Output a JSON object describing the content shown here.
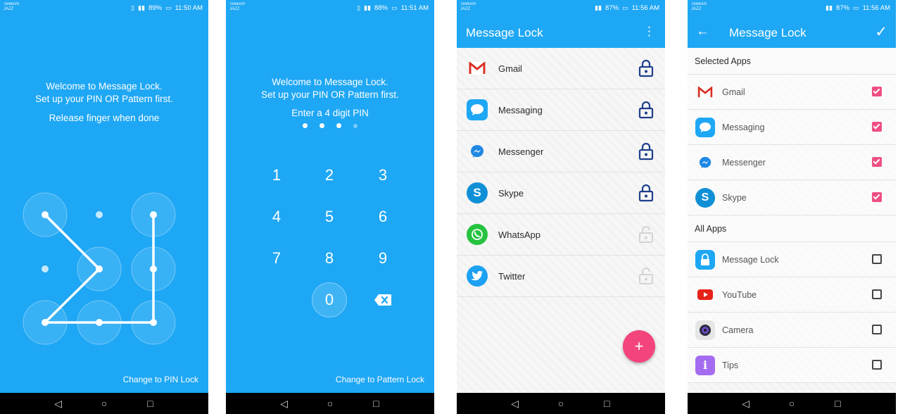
{
  "screen1": {
    "status": {
      "carrier": "Telekom\nJAZZ",
      "battery": "89%",
      "time": "11:50 AM"
    },
    "welcome_line1": "Welcome to Message Lock.",
    "welcome_line2": "Set up your PIN OR Pattern first.",
    "instruction": "Release finger when done",
    "change_link": "Change to PIN Lock"
  },
  "screen2": {
    "status": {
      "carrier": "Telekom\nJAZZ",
      "battery": "88%",
      "time": "11:51 AM"
    },
    "welcome_line1": "Welcome to Message Lock.",
    "welcome_line2": "Set up your PIN OR Pattern first.",
    "pin_prompt": "Enter a 4 digit PIN",
    "pin_entered": 3,
    "pin_length": 4,
    "keys": [
      "1",
      "2",
      "3",
      "4",
      "5",
      "6",
      "7",
      "8",
      "9",
      "0"
    ],
    "change_link": "Change to Pattern Lock"
  },
  "screen3": {
    "status": {
      "carrier": "Telekom\nJAZZ",
      "battery": "87%",
      "time": "11:56 AM"
    },
    "title": "Message Lock",
    "apps": [
      {
        "name": "Gmail",
        "icon": "gmail-icon",
        "locked": true
      },
      {
        "name": "Messaging",
        "icon": "messaging-icon",
        "locked": true
      },
      {
        "name": "Messenger",
        "icon": "messenger-icon",
        "locked": true
      },
      {
        "name": "Skype",
        "icon": "skype-icon",
        "locked": true
      },
      {
        "name": "WhatsApp",
        "icon": "whatsapp-icon",
        "locked": false
      },
      {
        "name": "Twitter",
        "icon": "twitter-icon",
        "locked": false
      }
    ],
    "fab_label": "+"
  },
  "screen4": {
    "status": {
      "carrier": "Telekom\nJAZZ",
      "battery": "87%",
      "time": "11:56 AM"
    },
    "title": "Message Lock",
    "selected_header": "Selected Apps",
    "selected": [
      {
        "name": "Gmail",
        "checked": true
      },
      {
        "name": "Messaging",
        "checked": true
      },
      {
        "name": "Messenger",
        "checked": true
      },
      {
        "name": "Skype",
        "checked": true
      }
    ],
    "all_header": "All Apps",
    "all": [
      {
        "name": "Message Lock",
        "checked": false
      },
      {
        "name": "YouTube",
        "checked": false
      },
      {
        "name": "Camera",
        "checked": false
      },
      {
        "name": "Tips",
        "checked": false
      }
    ]
  },
  "colors": {
    "primary": "#1ea7f4",
    "accent": "#f3447b",
    "checkbox": "#ef4f83",
    "lock_icon": "#1e3f8a"
  }
}
